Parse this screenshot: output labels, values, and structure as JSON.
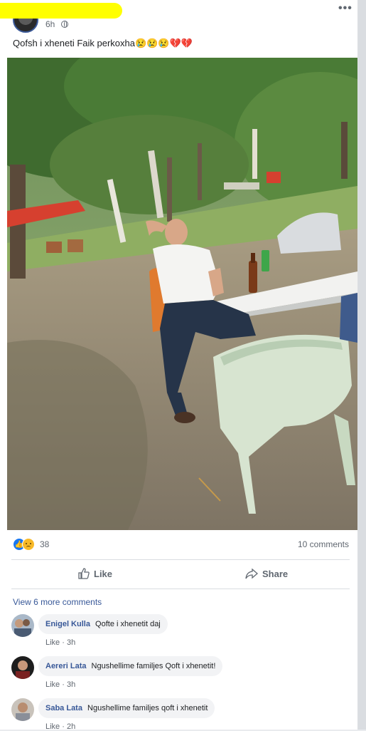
{
  "post": {
    "timestamp": "6h",
    "caption": "Qofsh i xheneti Faik perkoxha😢😢😢💔💔",
    "more_label": "•••"
  },
  "reactions": {
    "count": "38",
    "comments_count": "10 comments",
    "types": [
      "like",
      "sad"
    ]
  },
  "actions": {
    "like_label": "Like",
    "share_label": "Share"
  },
  "comments_section": {
    "view_more": "View 6 more comments",
    "items": [
      {
        "author": "Enigel Kulla",
        "text": "Qofte i xhenetit daj",
        "like": "Like",
        "time": "3h"
      },
      {
        "author": "Aereri Lata",
        "text": "Ngushellime familjes Qoft i xhenetit!",
        "like": "Like",
        "time": "3h"
      },
      {
        "author": "Saba Lata",
        "text": "Ngushellime familjes qoft i xhenetit",
        "like": "Like",
        "time": "2h"
      }
    ]
  },
  "colors": {
    "link": "#385898",
    "like_blue": "#1877f2",
    "meta_gray": "#606770",
    "redaction": "#ffff00"
  }
}
